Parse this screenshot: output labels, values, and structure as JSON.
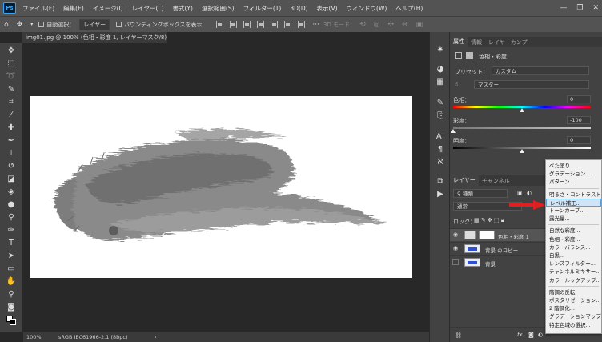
{
  "menubar": {
    "logo": "Ps",
    "items": [
      "ファイル(F)",
      "編集(E)",
      "イメージ(I)",
      "レイヤー(L)",
      "書式(Y)",
      "選択範囲(S)",
      "フィルター(T)",
      "3D(D)",
      "表示(V)",
      "ウィンドウ(W)",
      "ヘルプ(H)"
    ],
    "controls": [
      "—",
      "❐",
      "✕"
    ]
  },
  "optionsbar": {
    "auto_select_label": "自動選択：",
    "auto_select_value": "レイヤー",
    "bbox_label": "バウンディングボックスを表示",
    "mode_3d_label": "3D モード："
  },
  "document": {
    "tab_title": "img01.jpg @ 100% (色相・彩度 1, レイヤーマスク/8) *",
    "close": "×",
    "zoom": "100%",
    "color_profile": "sRGB IEC61966-2.1 (8bpc)",
    "status_arrow": "›"
  },
  "properties": {
    "tabs": [
      "属性",
      "情報",
      "レイヤーカンプ"
    ],
    "adjustment_title": "色相・彩度",
    "preset_label": "プリセット：",
    "preset_value": "カスタム",
    "channel_value": "マスター",
    "hue_label": "色相：",
    "hue_value": "0",
    "saturation_label": "彩度：",
    "saturation_value": "-100",
    "lightness_label": "明度：",
    "lightness_value": "0",
    "hue_position": 0.5,
    "saturation_position": 0.0,
    "lightness_position": 0.5
  },
  "layers": {
    "tabs": [
      "レイヤー",
      "チャンネル"
    ],
    "filter_label": "種類",
    "blend_mode": "通常",
    "lock_label": "ロック：",
    "rows": [
      {
        "name": "色相・彩度 1",
        "selected": true,
        "visible": true
      },
      {
        "name": "背景 のコピー",
        "selected": false,
        "visible": true
      },
      {
        "name": "背景",
        "selected": false,
        "visible": false
      }
    ],
    "bottom_label": "fx"
  },
  "popup_menu": {
    "groups": [
      [
        "べた塗り...",
        "グラデーション...",
        "パターン..."
      ],
      [
        "明るさ・コントラスト...",
        "レベル補正...",
        "トーンカーブ...",
        "露光量..."
      ],
      [
        "自然な彩度...",
        "色相・彩度...",
        "カラーバランス...",
        "白黒...",
        "レンズフィルター...",
        "チャンネルミキサー...",
        "カラールックアップ..."
      ],
      [
        "階調の反転",
        "ポスタリゼーション...",
        "2 階調化...",
        "グラデーションマップ...",
        "特定色域の選択..."
      ]
    ],
    "highlighted": "レベル補正..."
  },
  "colors": {
    "accent": "#31a8ff",
    "arrow": "#e02020",
    "highlight": "#cfe4f7"
  }
}
